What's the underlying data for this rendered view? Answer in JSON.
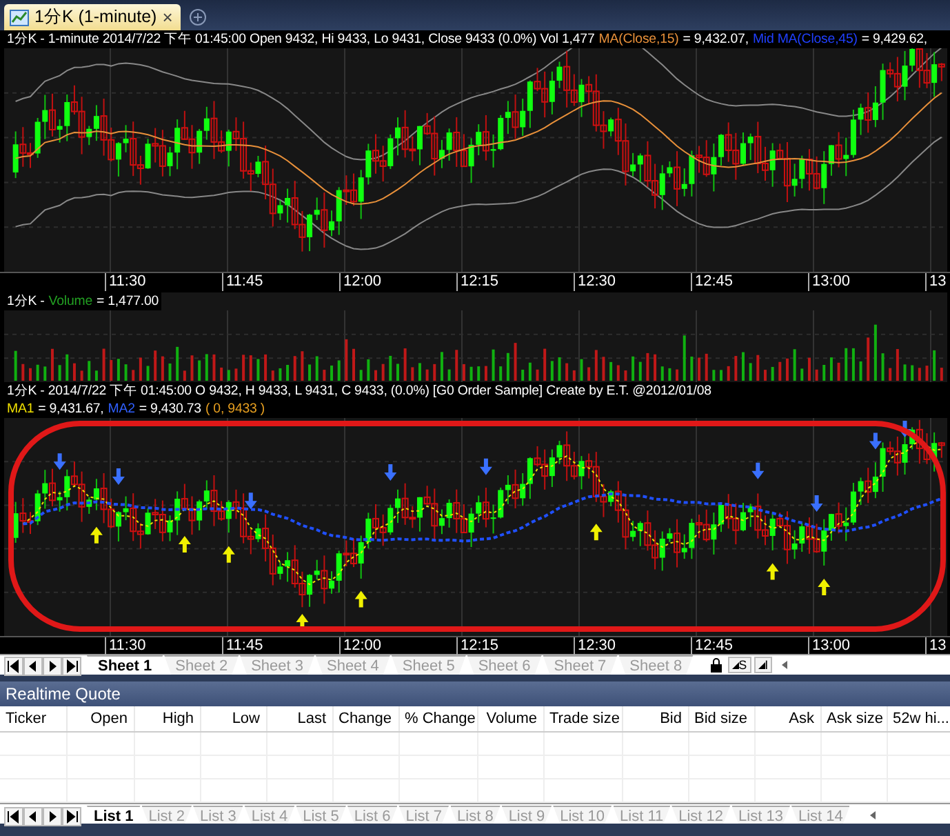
{
  "chart_tab": {
    "title": "1分K (1-minute)",
    "close": "×",
    "selected": true
  },
  "price_panel": {
    "legend": [
      {
        "text": "1分K - 1-minute 2014/7/22 下午 01:45:00 Open 9432, Hi 9433, Lo 9431, Close 9433 (0.0%) Vol 1,477",
        "color": "#ffffff"
      },
      {
        "text": "MA(Close,15)",
        "color": "#e8903a"
      },
      {
        "text": "= 9,432.07,",
        "color": "#ffffff"
      },
      {
        "text": "Mid MA(Close,45)",
        "color": "#2040ff"
      },
      {
        "text": "= 9,429.62,",
        "color": "#ffffff"
      }
    ]
  },
  "time_axis": [
    "11:30",
    "11:45",
    "12:00",
    "12:15",
    "12:30",
    "12:45",
    "13:00",
    "13"
  ],
  "volume_panel": {
    "legend": [
      {
        "text": "1分K -",
        "color": "#ffffff"
      },
      {
        "text": "Volume",
        "color": "#22a022"
      },
      {
        "text": "= 1,477.00",
        "color": "#ffffff"
      }
    ]
  },
  "indicator_panel": {
    "legend": [
      {
        "text": "1分K - 2014/7/22 下午 01:45:00 O 9432, H 9433, L 9431, C 9433, (0.0%) [G0 Order Sample] Create by E.T. @2012/01/08",
        "color": "#ffffff"
      }
    ],
    "legend_2": [
      {
        "text": "MA1",
        "color": "#f0e000"
      },
      {
        "text": "= 9,431.67,",
        "color": "#ffffff"
      },
      {
        "text": "MA2",
        "color": "#3060ff"
      },
      {
        "text": "= 9,430.73",
        "color": "#ffffff"
      },
      {
        "text": "( 0, 9433 )",
        "color": "#e8a020"
      }
    ]
  },
  "indicator_axis": [
    "11:30",
    "11:45",
    "12:00",
    "12:15",
    "12:30",
    "12:45",
    "13:00",
    "13"
  ],
  "sheet_tabs": [
    {
      "label": "Sheet 1",
      "selected": true
    },
    {
      "label": "Sheet 2",
      "selected": false
    },
    {
      "label": "Sheet 3",
      "selected": false
    },
    {
      "label": "Sheet 4",
      "selected": false
    },
    {
      "label": "Sheet 5",
      "selected": false
    },
    {
      "label": "Sheet 6",
      "selected": false
    },
    {
      "label": "Sheet 7",
      "selected": false
    },
    {
      "label": "Sheet 8",
      "selected": false
    }
  ],
  "sheet_tools": [
    {
      "label": "S"
    },
    {
      "label": "I"
    }
  ],
  "quote": {
    "title": "Realtime Quote",
    "columns": [
      "Ticker",
      "Open",
      "High",
      "Low",
      "Last",
      "Change",
      "% Change",
      "Volume",
      "Trade size",
      "Bid",
      "Bid size",
      "Ask",
      "Ask size",
      "52w hi..."
    ]
  },
  "list_tabs": [
    {
      "label": "List 1",
      "selected": true
    },
    {
      "label": "List 2",
      "selected": false
    },
    {
      "label": "List 3",
      "selected": false
    },
    {
      "label": "List 4",
      "selected": false
    },
    {
      "label": "List 5",
      "selected": false
    },
    {
      "label": "List 6",
      "selected": false
    },
    {
      "label": "List 7",
      "selected": false
    },
    {
      "label": "List 8",
      "selected": false
    },
    {
      "label": "List 9",
      "selected": false
    },
    {
      "label": "List 10",
      "selected": false
    },
    {
      "label": "List 11",
      "selected": false
    },
    {
      "label": "List 12",
      "selected": false
    },
    {
      "label": "List 13",
      "selected": false
    },
    {
      "label": "List 14",
      "selected": false
    }
  ]
}
